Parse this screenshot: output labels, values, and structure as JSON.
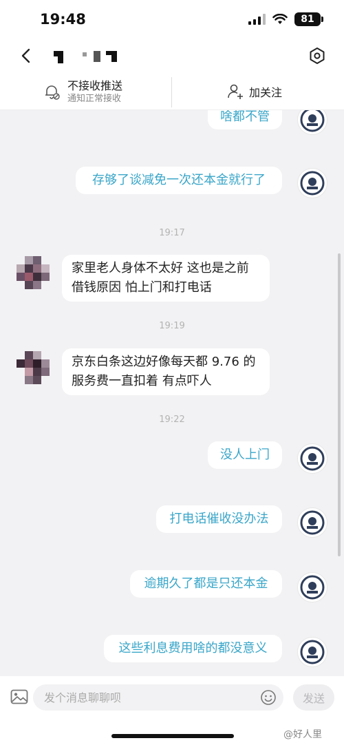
{
  "status_bar": {
    "time": "19:48",
    "battery": "81"
  },
  "nav": {
    "back_icon": "chevron-left-icon",
    "settings_icon": "hexagon-gear-icon"
  },
  "action_bar": {
    "notify_title": "不接收推送",
    "notify_subtitle": "通知正常接收",
    "follow_label": "加关注"
  },
  "messages": [
    {
      "side": "right",
      "text": "啥都不管"
    },
    {
      "side": "right",
      "text": "存够了谈减免一次还本金就行了"
    },
    {
      "side": "time",
      "text": "19:17"
    },
    {
      "side": "left",
      "lines": [
        "家里老人身体不太好 这也是之前",
        "借钱原因 怕上门和打电话"
      ]
    },
    {
      "side": "time",
      "text": "19:19"
    },
    {
      "side": "left",
      "lines": [
        "京东白条这边好像每天都 9.76 的",
        "服务费一直扣着 有点吓人"
      ]
    },
    {
      "side": "time",
      "text": "19:22"
    },
    {
      "side": "right",
      "text": "没人上门"
    },
    {
      "side": "right",
      "text": "打电话催收没办法"
    },
    {
      "side": "right",
      "text": "逾期久了都是只还本金"
    },
    {
      "side": "right",
      "text": "这些利息费用啥的都没意义"
    }
  ],
  "input": {
    "placeholder": "发个消息聊聊呗",
    "send_label": "发送"
  },
  "watermark": "@好人里"
}
